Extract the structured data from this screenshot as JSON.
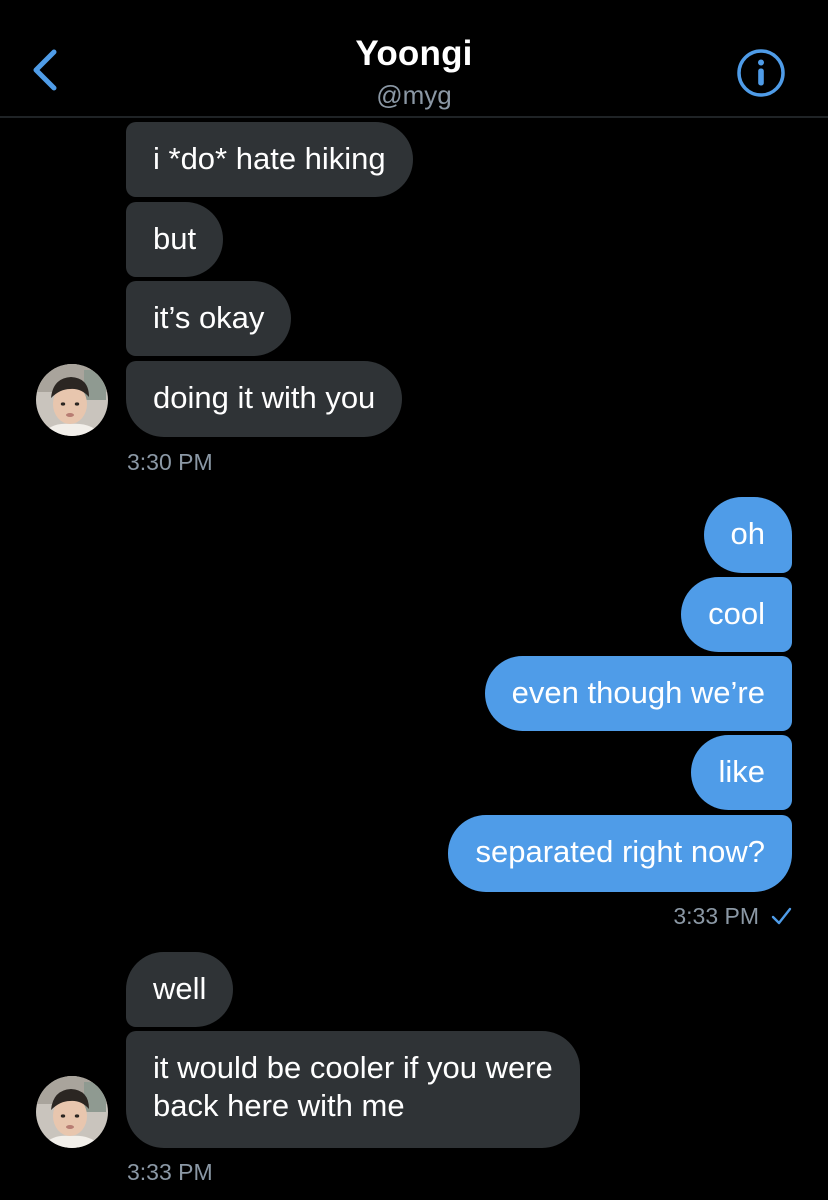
{
  "header": {
    "title": "Yoongi",
    "handle": "@myg",
    "back_icon": "chevron-left-icon",
    "info_icon": "info-icon",
    "accent_color": "#4f9ce8"
  },
  "messages": [
    {
      "sender": "them",
      "text": "i *do* hate hiking"
    },
    {
      "sender": "them",
      "text": "but"
    },
    {
      "sender": "them",
      "text": "it’s okay"
    },
    {
      "sender": "them",
      "text": "doing it with you"
    },
    {
      "sender": "me",
      "text": "oh"
    },
    {
      "sender": "me",
      "text": "cool"
    },
    {
      "sender": "me",
      "text": "even though we’re"
    },
    {
      "sender": "me",
      "text": "like"
    },
    {
      "sender": "me",
      "text": "separated right now?"
    },
    {
      "sender": "them",
      "text": "well"
    },
    {
      "sender": "them",
      "text": "it would be cooler if you were",
      "text2": "back here with me"
    }
  ],
  "timestamps": {
    "group1": "3:30 PM",
    "group2": "3:33 PM",
    "group3": "3:33 PM"
  },
  "status": {
    "read_icon": "checkmark-icon"
  },
  "colors": {
    "background": "#000000",
    "incoming_bubble": "#2f3336",
    "outgoing_bubble": "#4f9ce8",
    "secondary_text": "#8b98a5"
  }
}
